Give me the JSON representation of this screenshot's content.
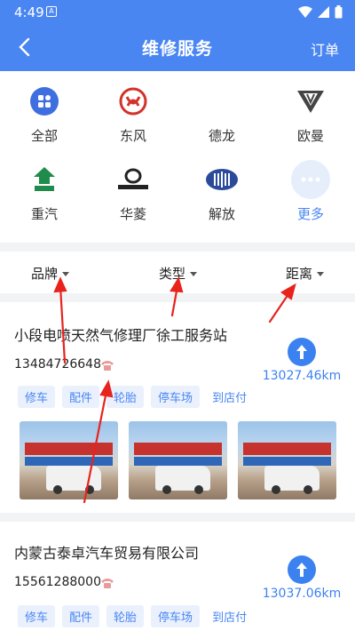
{
  "status_bar": {
    "time": "4:49",
    "notification_glyph": "A"
  },
  "header": {
    "title": "维修服务",
    "right_action": "订单"
  },
  "brands": [
    {
      "label": "全部",
      "icon": "grid-icon"
    },
    {
      "label": "东风",
      "icon": "dongfeng-logo-icon"
    },
    {
      "label": "德龙",
      "icon": "delong-logo-icon"
    },
    {
      "label": "欧曼",
      "icon": "auman-logo-icon"
    },
    {
      "label": "重汽",
      "icon": "sinotruk-logo-icon"
    },
    {
      "label": "华菱",
      "icon": "camc-logo-icon"
    },
    {
      "label": "解放",
      "icon": "faw-logo-icon"
    },
    {
      "label": "更多",
      "icon": "more-dots-icon"
    }
  ],
  "filters": {
    "brand": "品牌",
    "type": "类型",
    "distance": "距离"
  },
  "shops": [
    {
      "name": "小段电喷天然气修理厂徐工服务站",
      "phone": "13484726648",
      "tags": [
        "修车",
        "配件",
        "轮胎",
        "停车场"
      ],
      "tag_extra": "到店付",
      "distance": "13027.46km"
    },
    {
      "name": "内蒙古泰卓汽车贸易有限公司",
      "phone": "15561288000",
      "tags": [
        "修车",
        "配件",
        "轮胎",
        "停车场"
      ],
      "tag_extra": "到店付",
      "distance": "13037.06km"
    }
  ],
  "colors": {
    "primary": "#4a86f2",
    "annotation_arrow": "#e8231d"
  }
}
